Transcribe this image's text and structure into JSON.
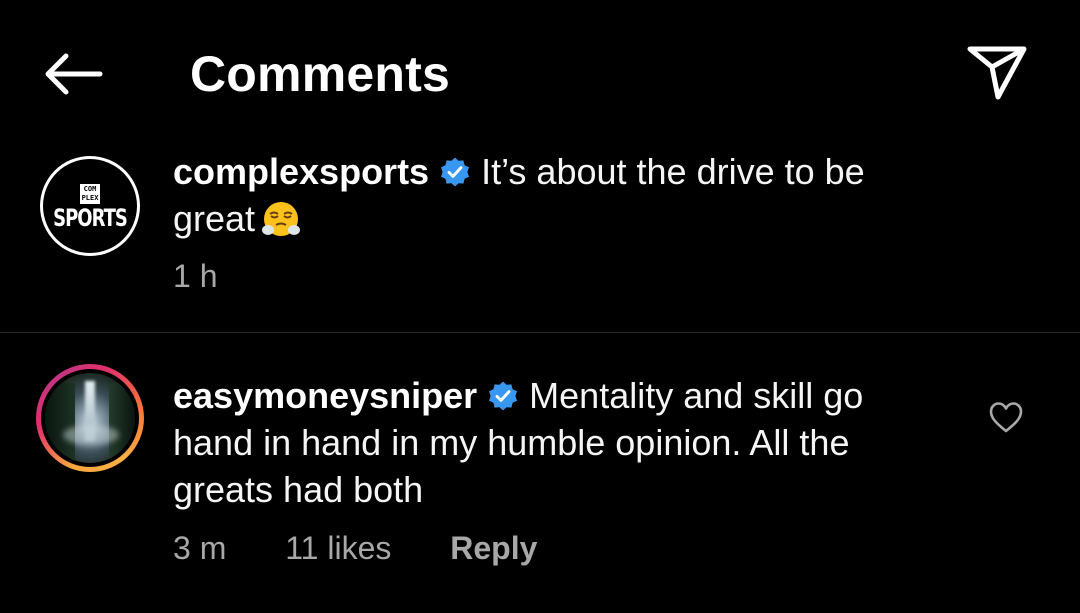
{
  "header": {
    "title": "Comments",
    "back_icon": "arrow-left-icon",
    "share_icon": "paper-plane-icon"
  },
  "comments": [
    {
      "username": "complexsports",
      "verified": true,
      "text_line1": "It’s about the drive to be",
      "text_line2": "great",
      "emoji": "face-with-steam-from-nose",
      "avatar_text_top": "COM PLEX",
      "avatar_text_bottom": "SPORTS",
      "time": "1 h"
    },
    {
      "username": "easymoneysniper",
      "verified": true,
      "text": "Mentality and skill go hand in hand in my humble opinion. All the greats had both",
      "time": "3 m",
      "likes": "11 likes",
      "reply_label": "Reply",
      "like_icon": "heart-outline-icon"
    }
  ],
  "colors": {
    "background": "#000000",
    "text": "#ffffff",
    "meta": "#a8a8a8",
    "verified": "#3897f0",
    "divider": "#262626"
  }
}
